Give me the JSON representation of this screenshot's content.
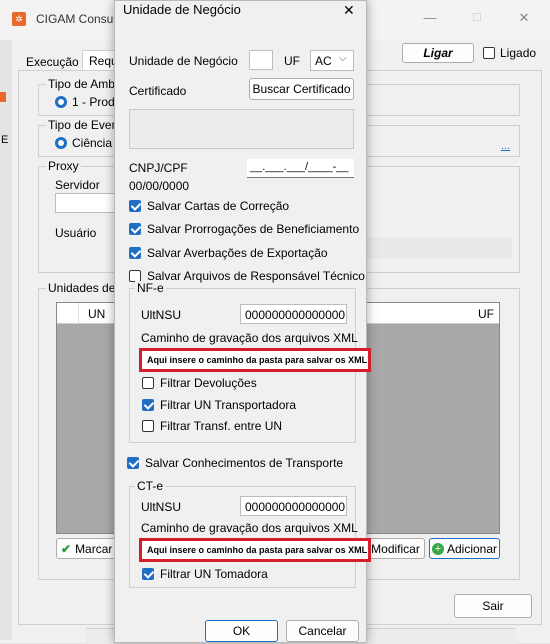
{
  "background_window": {
    "title": "CIGAM Consul",
    "tabs": [
      "Execução",
      "Requi"
    ],
    "ligar_label": "Ligar",
    "ligado_label": "Ligado",
    "tipo_ambiente_label": "Tipo de Ambie",
    "tipo_ambiente_value": "1 - Produ",
    "tipo_evento_label": "Tipo de Event",
    "tipo_evento_value": "Ciência c",
    "ellipsis": "...",
    "proxy_label": "Proxy",
    "servidor_label": "Servidor",
    "usuario_label": "Usuário",
    "unidades_label": "Unidades de N",
    "table_col_un": "UN",
    "table_col_uf": "UF",
    "marcar_label": "Marcar",
    "modificar_label": "Modificar",
    "adicionar_label": "Adicionar",
    "sair_label": "Sair"
  },
  "dialog": {
    "title": "Unidade de Negócio",
    "close_glyph": "✕",
    "unidade_negocio_label": "Unidade de Negócio",
    "uf_label": "UF",
    "uf_value": "AC",
    "certificado_label": "Certificado",
    "buscar_certificado_label": "Buscar Certificado",
    "cnpj_label": "CNPJ/CPF",
    "cnpj_mask": "__.___.___/____-__",
    "cnpj_value": "00/00/0000",
    "salvar_cartas": "Salvar Cartas de Correção",
    "salvar_prorrogacoes": "Salvar Prorrogações de Beneficiamento",
    "salvar_averbacoes": "Salvar Averbações de Exportação",
    "salvar_arquivos_resp": "Salvar Arquivos de Responsável Técnico",
    "nfe": {
      "group_label": "NF-e",
      "ultnsu_label": "UltNSU",
      "ultnsu_value": "000000000000000",
      "caminho_label": "Caminho de gravação dos arquivos XML",
      "caminho_value": "Aqui insere o caminho da pasta para salvar os XML´s",
      "filtrar_devolucoes": "Filtrar Devoluções",
      "filtrar_un_transportadora": "Filtrar UN Transportadora",
      "filtrar_transf": "Filtrar Transf. entre UN"
    },
    "salvar_conhecimentos": "Salvar Conhecimentos de Transporte",
    "cte": {
      "group_label": "CT-e",
      "ultnsu_label": "UltNSU",
      "ultnsu_value": "000000000000000",
      "caminho_label": "Caminho de gravação dos arquivos XML",
      "caminho_value": "Aqui insere o caminho da pasta para salvar os XML´s",
      "filtrar_un_tomadora": "Filtrar UN Tomadora"
    },
    "ok_label": "OK",
    "cancelar_label": "Cancelar"
  },
  "colors": {
    "accent": "#1f6fc4",
    "highlight_red": "#d41e2b",
    "app_icon": "#e8692a"
  }
}
